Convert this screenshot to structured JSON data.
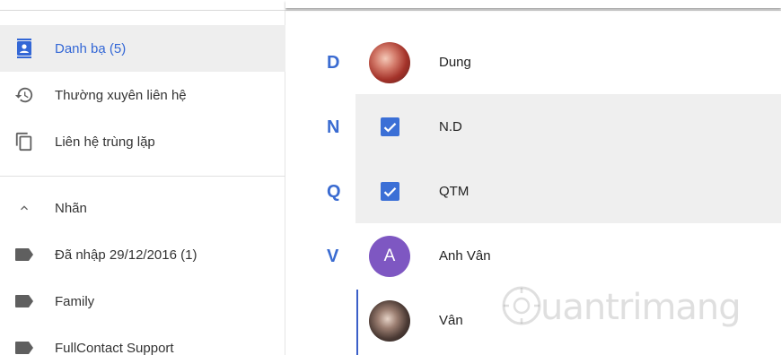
{
  "sidebar": {
    "items": [
      {
        "label": "Danh bạ (5)",
        "icon": "contacts-icon",
        "active": true
      },
      {
        "label": "Thường xuyên liên hệ",
        "icon": "history-icon"
      },
      {
        "label": "Liên hệ trùng lặp",
        "icon": "copy-icon"
      }
    ],
    "labels_header": {
      "label": "Nhãn",
      "icon": "chevron-up-icon"
    },
    "labels": [
      {
        "label": "Đã nhập 29/12/2016 (1)",
        "icon": "label-icon"
      },
      {
        "label": "Family",
        "icon": "label-icon"
      },
      {
        "label": "FullContact Support",
        "icon": "label-icon"
      }
    ]
  },
  "contacts": [
    {
      "letter": "D",
      "name": "Dung",
      "avatar": "photo",
      "selected": false
    },
    {
      "letter": "N",
      "name": "N.D",
      "selected": true
    },
    {
      "letter": "Q",
      "name": "QTM",
      "selected": true
    },
    {
      "letter": "V",
      "name": "Anh Vân",
      "avatar_initial": "A",
      "selected": false
    },
    {
      "letter": "",
      "name": "Vân",
      "avatar": "photo",
      "selected": false
    }
  ],
  "colors": {
    "accent": "#3367d6",
    "letter": "#3a6bd1",
    "checkbox": "#3b6fd6",
    "avatar_initial_bg": "#7e57c2",
    "selected_row_bg": "#efefef"
  },
  "watermark": {
    "text": "uantrimang"
  }
}
